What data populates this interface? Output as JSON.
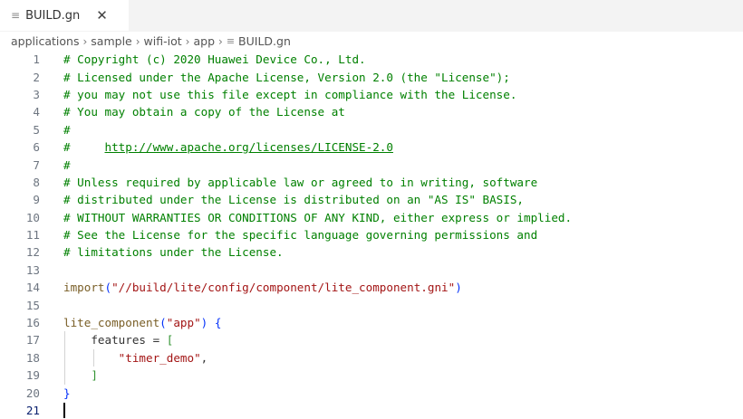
{
  "tab": {
    "file_icon": "≡",
    "label": "BUILD.gn",
    "close_glyph": "✕"
  },
  "breadcrumb": {
    "items": [
      "applications",
      "sample",
      "wifi-iot",
      "app"
    ],
    "separator": "›",
    "file_icon": "≡",
    "file": "BUILD.gn"
  },
  "lines": [
    {
      "n": "1",
      "text": "# Copyright (c) 2020 Huawei Device Co., Ltd."
    },
    {
      "n": "2",
      "text": "# Licensed under the Apache License, Version 2.0 (the \"License\");"
    },
    {
      "n": "3",
      "text": "# you may not use this file except in compliance with the License."
    },
    {
      "n": "4",
      "text": "# You may obtain a copy of the License at"
    },
    {
      "n": "5",
      "text": "#"
    },
    {
      "n": "6",
      "text": "#     ",
      "link": "http://www.apache.org/licenses/LICENSE-2.0"
    },
    {
      "n": "7",
      "text": "#"
    },
    {
      "n": "8",
      "text": "# Unless required by applicable law or agreed to in writing, software"
    },
    {
      "n": "9",
      "text": "# distributed under the License is distributed on an \"AS IS\" BASIS,"
    },
    {
      "n": "10",
      "text": "# WITHOUT WARRANTIES OR CONDITIONS OF ANY KIND, either express or implied."
    },
    {
      "n": "11",
      "text": "# See the License for the specific language governing permissions and"
    },
    {
      "n": "12",
      "text": "# limitations under the License."
    },
    {
      "n": "13",
      "text": ""
    },
    {
      "n": "14",
      "fn": "import",
      "open": "(",
      "str": "\"//build/lite/config/component/lite_component.gni\"",
      "close": ")"
    },
    {
      "n": "15",
      "text": ""
    },
    {
      "n": "16",
      "fn": "lite_component",
      "open": "(",
      "str": "\"app\"",
      "close": ")",
      "tail": " {"
    },
    {
      "n": "17",
      "indent": "    ",
      "var": "features = ",
      "bracket": "["
    },
    {
      "n": "18",
      "indent": "        ",
      "str": "\"timer_demo\"",
      "tail": ","
    },
    {
      "n": "19",
      "indent": "    ",
      "bracket": "]"
    },
    {
      "n": "20",
      "brace": "}"
    },
    {
      "n": "21",
      "text": ""
    }
  ],
  "current_line": "21"
}
